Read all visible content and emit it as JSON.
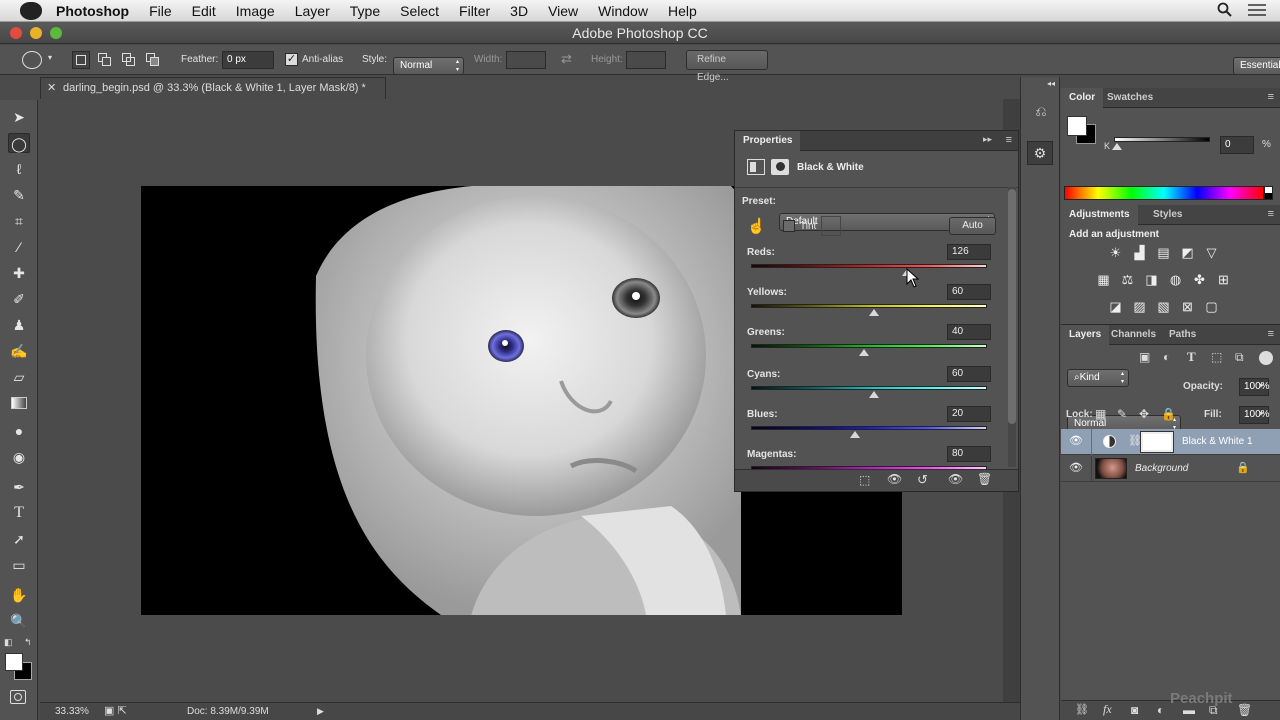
{
  "menubar": {
    "app": "Photoshop",
    "items": [
      "File",
      "Edit",
      "Image",
      "Layer",
      "Type",
      "Select",
      "Filter",
      "3D",
      "View",
      "Window",
      "Help"
    ]
  },
  "window": {
    "title": "Adobe Photoshop CC"
  },
  "options": {
    "feather_label": "Feather:",
    "feather_value": "0 px",
    "antialias_label": "Anti-alias",
    "style_label": "Style:",
    "style_value": "Normal",
    "width_label": "Width:",
    "height_label": "Height:",
    "refine_button": "Refine Edge...",
    "workspace": "Essentials"
  },
  "document": {
    "tab_title": "darling_begin.psd @ 33.3% (Black & White 1, Layer Mask/8) *",
    "zoom": "33.33%",
    "doc_size": "Doc: 8.39M/9.39M"
  },
  "properties": {
    "tab": "Properties",
    "title": "Black & White",
    "preset_label": "Preset:",
    "preset_value": "Default",
    "tint_label": "Tint",
    "auto_button": "Auto",
    "sliders": [
      {
        "label": "Reds:",
        "value": "126",
        "pos": 0.66,
        "grad": "linear-gradient(90deg,#1b0606,#6a1010,#c82424,#ff5050,#ffd0d0)"
      },
      {
        "label": "Yellows:",
        "value": "60",
        "pos": 0.52,
        "grad": "linear-gradient(90deg,#141404,#5e5e0c,#bcbc1c,#f2f24a,#ffffc8)"
      },
      {
        "label": "Greens:",
        "value": "40",
        "pos": 0.48,
        "grad": "linear-gradient(90deg,#041404,#0c5e0c,#1cbc1c,#4af24a,#c8ffc8)"
      },
      {
        "label": "Cyans:",
        "value": "60",
        "pos": 0.52,
        "grad": "linear-gradient(90deg,#041414,#0c5e5e,#1cbcbc,#4af2f2,#c8ffff)"
      },
      {
        "label": "Blues:",
        "value": "20",
        "pos": 0.44,
        "grad": "linear-gradient(90deg,#04041a,#0c0c6e,#1c1cd0,#5050ff,#d0d0ff)"
      },
      {
        "label": "Magentas:",
        "value": "80",
        "pos": 0.56,
        "grad": "linear-gradient(90deg,#140414,#5e0c5e,#bc1cbc,#f24af2,#ffc8ff)"
      }
    ]
  },
  "color_panel": {
    "tabs": [
      "Color",
      "Swatches"
    ],
    "k_label": "K",
    "k_value": "0",
    "percent": "%"
  },
  "adjustments_panel": {
    "tabs": [
      "Adjustments",
      "Styles"
    ],
    "heading": "Add an adjustment"
  },
  "layers_panel": {
    "tabs": [
      "Layers",
      "Channels",
      "Paths"
    ],
    "kind": "Kind",
    "blend_mode": "Normal",
    "opacity_label": "Opacity:",
    "opacity_value": "100%",
    "lock_label": "Lock:",
    "fill_label": "Fill:",
    "fill_value": "100%",
    "layers": [
      {
        "name": "Black & White 1"
      },
      {
        "name": "Background"
      }
    ]
  },
  "watermark": "Peachpit"
}
